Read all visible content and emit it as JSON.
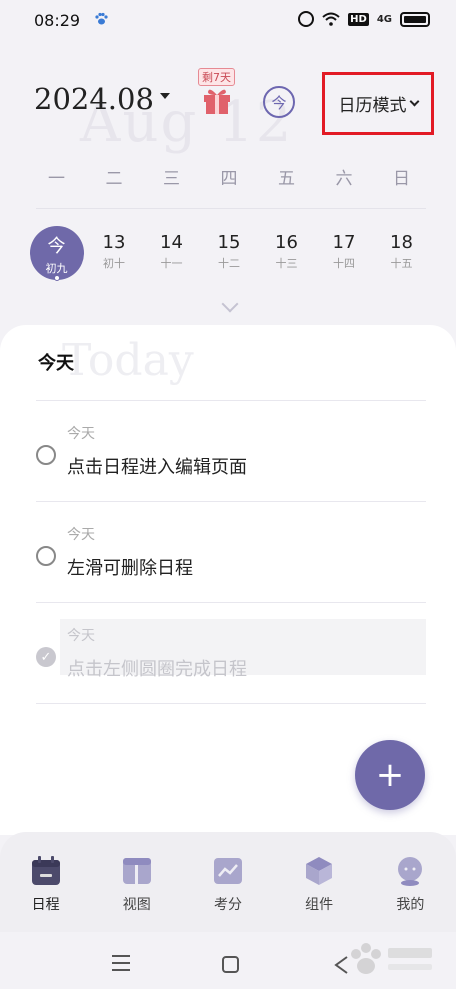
{
  "status_bar": {
    "time": "08:29",
    "hd_label": "HD",
    "network_label": "4G"
  },
  "header": {
    "month": "2024.08",
    "watermark": "Aug 12",
    "gift_badge": "剩7天",
    "today_button": "今",
    "mode_label": "日历模式"
  },
  "weekdays": [
    "一",
    "二",
    "三",
    "四",
    "五",
    "六",
    "日"
  ],
  "week_days": [
    {
      "num": "今",
      "lunar": "初九",
      "today": true
    },
    {
      "num": "13",
      "lunar": "初十"
    },
    {
      "num": "14",
      "lunar": "十一"
    },
    {
      "num": "15",
      "lunar": "十二"
    },
    {
      "num": "16",
      "lunar": "十三"
    },
    {
      "num": "17",
      "lunar": "十四"
    },
    {
      "num": "18",
      "lunar": "十五"
    }
  ],
  "section": {
    "title": "今天",
    "watermark": "Today"
  },
  "tasks": [
    {
      "date": "今天",
      "title": "点击日程进入编辑页面",
      "done": false
    },
    {
      "date": "今天",
      "title": "左滑可删除日程",
      "done": false
    },
    {
      "date": "今天",
      "title": "点击左侧圆圈完成日程",
      "done": true
    }
  ],
  "fab_label": "+",
  "bottom_nav": [
    {
      "label": "日程",
      "icon": "calendar-icon",
      "active": true
    },
    {
      "label": "视图",
      "icon": "layout-icon"
    },
    {
      "label": "考分",
      "icon": "chart-icon"
    },
    {
      "label": "组件",
      "icon": "cube-icon"
    },
    {
      "label": "我的",
      "icon": "avatar-icon"
    }
  ],
  "colors": {
    "accent": "#6f69a9",
    "highlight_box": "#e21b25",
    "title_marker": "#fbe6bf"
  }
}
